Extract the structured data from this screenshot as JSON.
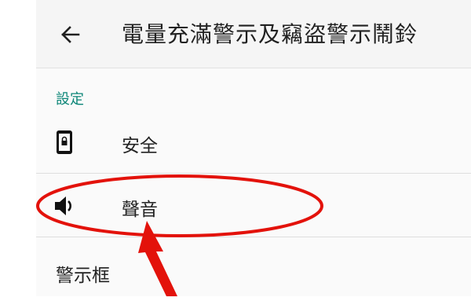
{
  "toolbar": {
    "back_icon": "arrow-back-icon",
    "title": "電量充滿警示及竊盜警示鬧鈴"
  },
  "settings": {
    "section_header": "設定",
    "items": [
      {
        "label": "安全",
        "icon": "phone-lock-icon"
      },
      {
        "label": "聲音",
        "icon": "volume-icon"
      },
      {
        "label": "警示框"
      }
    ]
  },
  "colors": {
    "accent": "#0b8577",
    "annotation": "#e3120b",
    "toolbar_bg": "#f5f5f5",
    "panel_bg": "#fafafa"
  }
}
